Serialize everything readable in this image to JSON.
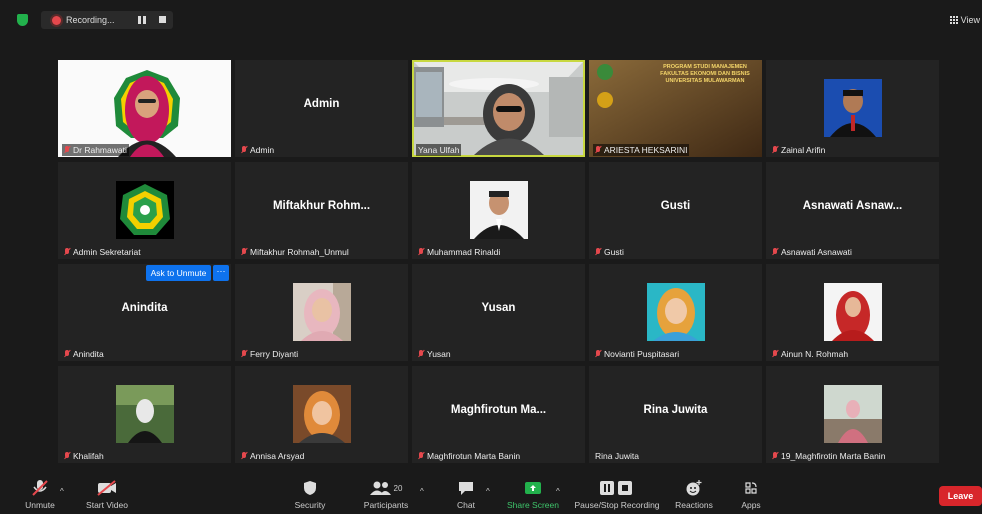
{
  "topbar": {
    "recording_label": "Recording...",
    "view_label": "View"
  },
  "tiles": {
    "t1": {
      "name": "Dr Rahmawati"
    },
    "t2": {
      "center": "Admin",
      "name": "Admin"
    },
    "t3": {
      "name": "Yana Ulfah"
    },
    "t4": {
      "name": "ARIESTA HEKSARINI",
      "banner_line1": "PROGRAM STUDI MANAJEMEN",
      "banner_line2": "FAKULTAS EKONOMI DAN BISNIS",
      "banner_line3": "UNIVERSITAS MULAWARMAN"
    },
    "t5": {
      "name": "Zainal Arifin"
    },
    "t6": {
      "name": "Admin Sekretariat"
    },
    "t7": {
      "center": "Miftakhur  Rohm...",
      "name": "Miftakhur Rohmah_Unmul"
    },
    "t8": {
      "name": "Muhammad Rinaldi"
    },
    "t9": {
      "center": "Gusti",
      "name": "Gusti"
    },
    "t10": {
      "center": "Asnawati  Asnaw...",
      "name": "Asnawati Asnawati"
    },
    "t11": {
      "center": "Anindita",
      "name": "Anindita"
    },
    "t12": {
      "name": "Ferry Diyanti"
    },
    "t13": {
      "center": "Yusan",
      "name": "Yusan"
    },
    "t14": {
      "name": "Novianti Puspitasari"
    },
    "t15": {
      "name": "Ainun N. Rohmah"
    },
    "t16": {
      "name": "Khalifah"
    },
    "t17": {
      "name": "Annisa Arsyad"
    },
    "t18": {
      "center": "Maghfirotun  Ma...",
      "name": "Maghfirotun Marta Banin"
    },
    "t19": {
      "center": "Rina Juwita",
      "name": "Rina Juwita"
    },
    "t20": {
      "name": "19_Maghfirotin Marta Banin"
    }
  },
  "overlay": {
    "ask_unmute": "Ask to Unmute",
    "more": "···"
  },
  "toolbar": {
    "unmute": "Unmute",
    "start_video": "Start Video",
    "security": "Security",
    "participants": "Participants",
    "participant_count": "20",
    "chat": "Chat",
    "share_screen": "Share Screen",
    "pause_stop": "Pause/Stop Recording",
    "reactions": "Reactions",
    "apps": "Apps",
    "leave": "Leave"
  },
  "colors": {
    "accent_green": "#22b14c",
    "leave_red": "#d8262b",
    "active_outline": "#c8d840",
    "button_blue": "#0e72ed"
  }
}
